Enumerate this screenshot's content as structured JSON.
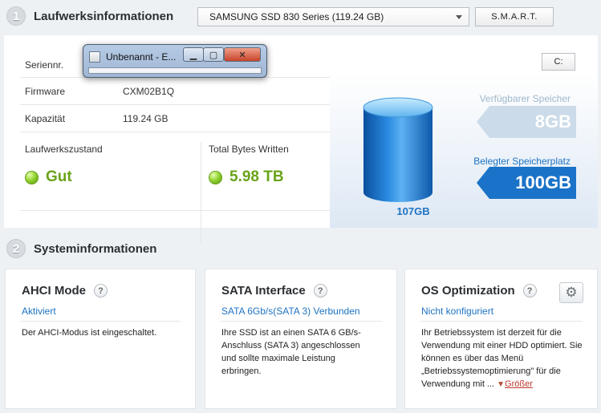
{
  "drive_section": {
    "number": "1",
    "title": "Laufwerksinformationen",
    "drive_select": "SAMSUNG SSD 830 Series (119.24 GB)",
    "smart_button": "S.M.A.R.T."
  },
  "drive_info": {
    "rows": [
      {
        "label": "Seriennr.",
        "value": ""
      },
      {
        "label": "Firmware",
        "value": "CXM02B1Q"
      },
      {
        "label": "Kapazität",
        "value": "119.24 GB"
      }
    ],
    "health_label": "Laufwerkszustand",
    "health_value": "Gut",
    "tbw_label": "Total Bytes Written",
    "tbw_value": "5.98 TB"
  },
  "storage": {
    "drive_letter": "C:",
    "free_label": "Verfügbarer Speicher",
    "free_value": "8GB",
    "used_label": "Belegter Speicherplatz",
    "used_value": "100GB",
    "total": "107GB",
    "colors": {
      "used": "#1a73c8",
      "free": "#ccdbe9",
      "cylinder": "#1e78d0"
    }
  },
  "overlay_window": {
    "title": "Unbenannt - E...",
    "min_glyph": "▁",
    "max_glyph": "▢",
    "close_glyph": "✕"
  },
  "system_section": {
    "number": "2",
    "title": "Systeminformationen"
  },
  "cards": [
    {
      "title": "AHCI Mode",
      "status": "Aktiviert",
      "description": "Der AHCI-Modus ist eingeschaltet."
    },
    {
      "title": "SATA Interface",
      "status": "SATA 6Gb/s(SATA 3) Verbunden",
      "description": "Ihre SSD ist an einen SATA 6 GB/s-Anschluss (SATA 3) angeschlossen und sollte maximale Leistung erbringen."
    },
    {
      "title": "OS Optimization",
      "status": "Nicht konfiguriert",
      "description": "Ihr Betriebssystem ist derzeit für die Verwendung mit einer HDD optimiert. Sie können es über das Menü „Betriebssystemoptimierung\" für die Verwendung mit ...",
      "more": "Größer"
    }
  ],
  "icons": {
    "help": "?",
    "gear": "⚙",
    "more_arrow": "▼"
  }
}
